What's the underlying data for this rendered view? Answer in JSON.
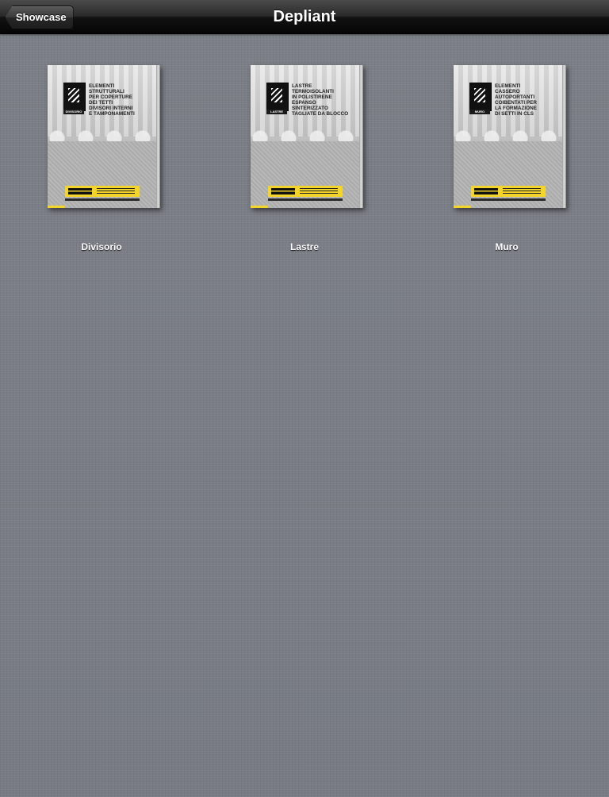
{
  "navbar": {
    "title": "Depliant",
    "back_label": "Showcase"
  },
  "items": [
    {
      "caption": "Divisorio",
      "cover_title": "ELEMENTI\nSTRUTTURALI\nPER COPERTURE\nDEI TETTI\nDIVISORI INTERNI\nE TAMPONAMENTI",
      "cover_badge": "DIVISORIO"
    },
    {
      "caption": "Lastre",
      "cover_title": "LASTRE\nTERMOISOLANTI\nIN POLISTIRENE\nESPANSO\nSINTERIZZATO\nTAGLIATE DA BLOCCO",
      "cover_badge": "LASTRE"
    },
    {
      "caption": "Muro",
      "cover_title": "ELEMENTI\nCASSERO\nAUTOPORTANTI\nCOIBENTATI PER\nLA FORMAZIONE\nDI SETTI IN CLS",
      "cover_badge": "MURO"
    }
  ],
  "colors": {
    "background": "#7b7e86",
    "band_yellow": "#f2d42b"
  }
}
